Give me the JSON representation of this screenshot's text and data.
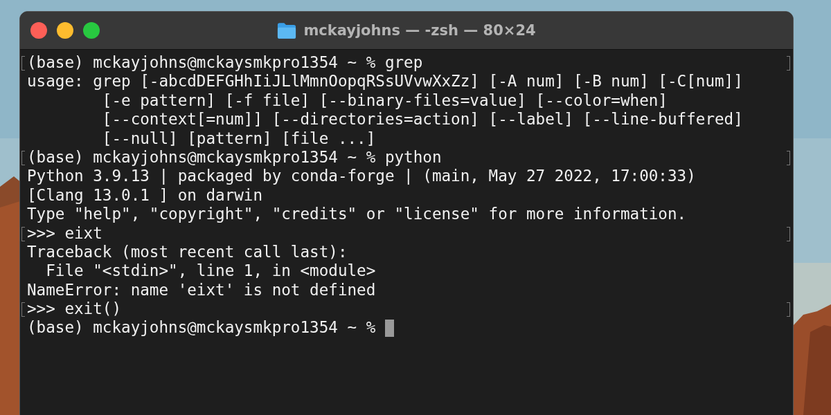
{
  "window": {
    "title": "mckayjohns — -zsh — 80×24"
  },
  "lines": [
    {
      "text": "(base) mckayjohns@mckaysmkpro1354 ~ % grep",
      "marked": true,
      "cursor": false
    },
    {
      "text": "usage: grep [-abcdDEFGHhIiJLlMmnOopqRSsUVvwXxZz] [-A num] [-B num] [-C[num]]",
      "marked": false,
      "cursor": false
    },
    {
      "text": "        [-e pattern] [-f file] [--binary-files=value] [--color=when]",
      "marked": false,
      "cursor": false
    },
    {
      "text": "        [--context[=num]] [--directories=action] [--label] [--line-buffered]",
      "marked": false,
      "cursor": false
    },
    {
      "text": "        [--null] [pattern] [file ...]",
      "marked": false,
      "cursor": false
    },
    {
      "text": "(base) mckayjohns@mckaysmkpro1354 ~ % python",
      "marked": true,
      "cursor": false
    },
    {
      "text": "Python 3.9.13 | packaged by conda-forge | (main, May 27 2022, 17:00:33)",
      "marked": false,
      "cursor": false
    },
    {
      "text": "[Clang 13.0.1 ] on darwin",
      "marked": false,
      "cursor": false
    },
    {
      "text": "Type \"help\", \"copyright\", \"credits\" or \"license\" for more information.",
      "marked": false,
      "cursor": false
    },
    {
      "text": ">>> eixt",
      "marked": true,
      "cursor": false
    },
    {
      "text": "Traceback (most recent call last):",
      "marked": false,
      "cursor": false
    },
    {
      "text": "  File \"<stdin>\", line 1, in <module>",
      "marked": false,
      "cursor": false
    },
    {
      "text": "NameError: name 'eixt' is not defined",
      "marked": false,
      "cursor": false
    },
    {
      "text": ">>> exit()",
      "marked": true,
      "cursor": false
    },
    {
      "text": "(base) mckayjohns@mckaysmkpro1354 ~ % ",
      "marked": false,
      "cursor": true
    }
  ]
}
